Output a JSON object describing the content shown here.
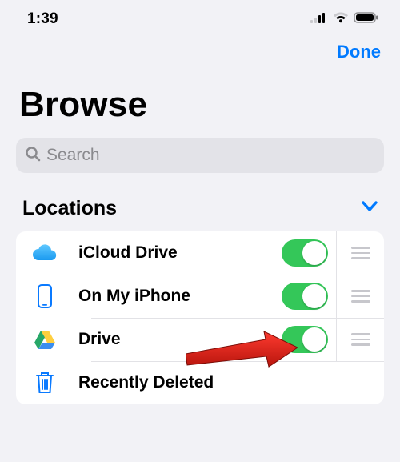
{
  "status": {
    "time": "1:39"
  },
  "nav": {
    "done": "Done"
  },
  "title": "Browse",
  "search": {
    "placeholder": "Search"
  },
  "section": {
    "label": "Locations"
  },
  "rows": {
    "icloud": {
      "label": "iCloud Drive",
      "enabled": true
    },
    "phone": {
      "label": "On My iPhone",
      "enabled": true
    },
    "drive": {
      "label": "Drive",
      "enabled": true
    },
    "trash": {
      "label": "Recently Deleted"
    }
  }
}
